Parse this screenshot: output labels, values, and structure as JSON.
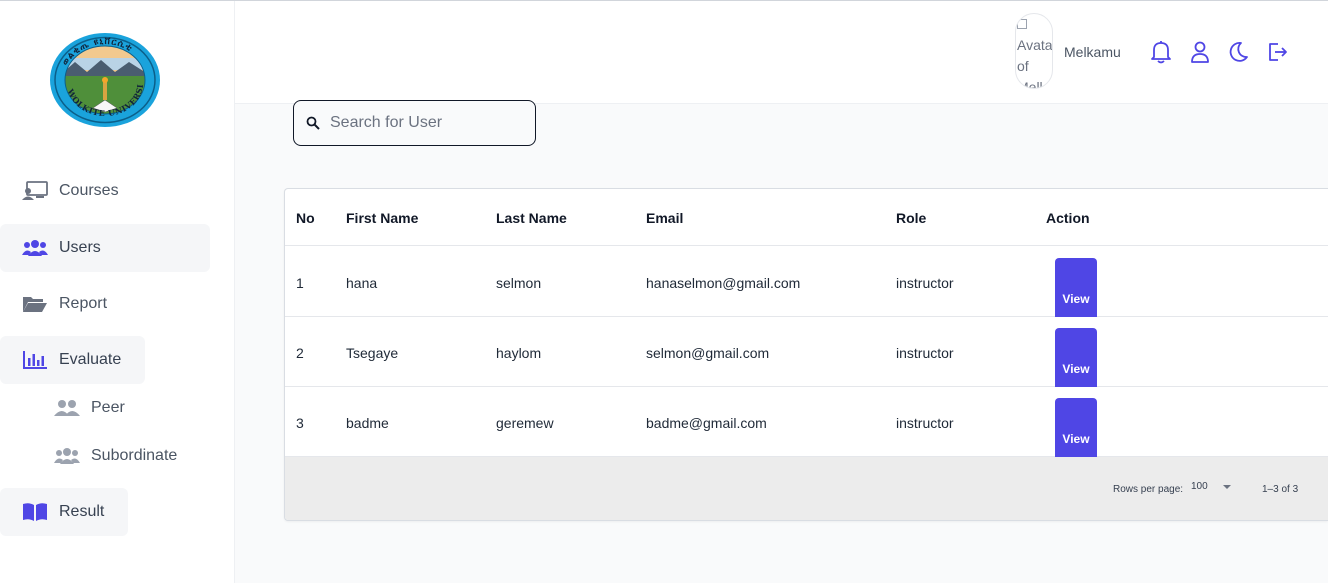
{
  "sidebar": {
    "logo_text": "WOLKITE UNIVERSITY",
    "items": [
      {
        "label": "Courses",
        "icon": "courses-icon"
      },
      {
        "label": "Users",
        "icon": "users-icon"
      },
      {
        "label": "Report",
        "icon": "folder-icon"
      },
      {
        "label": "Evaluate",
        "icon": "chart-icon"
      },
      {
        "label": "Peer",
        "icon": "peer-icon"
      },
      {
        "label": "Subordinate",
        "icon": "subordinate-icon"
      },
      {
        "label": "Result",
        "icon": "book-icon"
      }
    ]
  },
  "header": {
    "avatar_alt": "Avatar of Melk",
    "username": "Melkamu",
    "icons": [
      "bell-icon",
      "user-icon",
      "moon-icon",
      "logout-icon"
    ]
  },
  "search": {
    "placeholder": "Search for User",
    "value": ""
  },
  "table": {
    "columns": [
      "No",
      "First Name",
      "Last Name",
      "Email",
      "Role",
      "Action"
    ],
    "rows": [
      {
        "no": "1",
        "first": "hana",
        "last": "selmon",
        "email": "hanaselmon@gmail.com",
        "role": "instructor",
        "action": "View"
      },
      {
        "no": "2",
        "first": "Tsegaye",
        "last": "haylom",
        "email": "selmon@gmail.com",
        "role": "instructor",
        "action": "View"
      },
      {
        "no": "3",
        "first": "badme",
        "last": "geremew",
        "email": "badme@gmail.com",
        "role": "instructor",
        "action": "View"
      }
    ],
    "footer": {
      "rows_per_page_label": "Rows per page:",
      "rows_per_page_value": "100",
      "range": "1–3 of 3"
    }
  },
  "colors": {
    "accent": "#4f46e5",
    "sidebar_active": "#f5f6f8",
    "footer_bg": "#ececec"
  }
}
